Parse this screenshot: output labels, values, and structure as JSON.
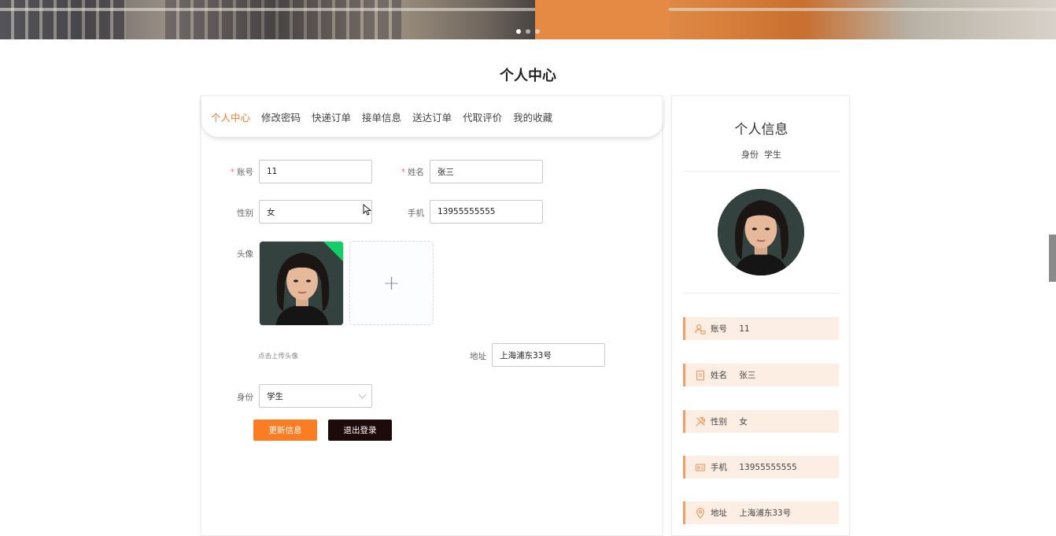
{
  "page": {
    "title": "个人中心"
  },
  "tabs": [
    {
      "label": "个人中心",
      "active": true
    },
    {
      "label": "修改密码"
    },
    {
      "label": "快递订单"
    },
    {
      "label": "接单信息"
    },
    {
      "label": "送达订单"
    },
    {
      "label": "代取评价"
    },
    {
      "label": "我的收藏"
    }
  ],
  "form": {
    "account": {
      "label": "账号",
      "value": "11",
      "required": true
    },
    "name": {
      "label": "姓名",
      "value": "张三",
      "required": true
    },
    "gender": {
      "label": "性别",
      "value": "女"
    },
    "phone": {
      "label": "手机",
      "value": "13955555555"
    },
    "avatar": {
      "label": "头像",
      "upload_icon": "+",
      "hint": "点击上传头像"
    },
    "address": {
      "label": "地址",
      "value": "上海浦东33号"
    },
    "role": {
      "label": "身份",
      "value": "学生"
    },
    "update_button": "更新信息",
    "logout_button": "退出登录"
  },
  "side": {
    "title": "个人信息",
    "role_label": "身份",
    "role_value": "学生",
    "items": [
      {
        "icon": "user-card-icon",
        "label": "账号",
        "value": "11"
      },
      {
        "icon": "document-icon",
        "label": "姓名",
        "value": "张三"
      },
      {
        "icon": "tools-icon",
        "label": "性别",
        "value": "女"
      },
      {
        "icon": "id-card-icon",
        "label": "手机",
        "value": "13955555555"
      },
      {
        "icon": "location-icon",
        "label": "地址",
        "value": "上海浦东33号"
      }
    ]
  },
  "colors": {
    "accent": "#f07c2c",
    "update_button": "#fa7d24",
    "logout_button": "#1d0a0a",
    "side_item_bg": "#fdeee4",
    "side_item_border": "#f0a066"
  }
}
